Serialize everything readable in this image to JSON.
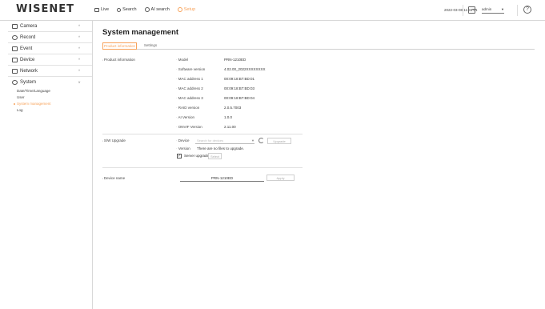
{
  "header": {
    "logo": "WISENET",
    "nav": [
      {
        "label": "Live",
        "icon": "live-icon"
      },
      {
        "label": "Search",
        "icon": "search-icon"
      },
      {
        "label": "AI search",
        "icon": "ai-search-icon"
      },
      {
        "label": "Setup",
        "icon": "gear-icon"
      }
    ],
    "datetime": "2022-03-08 11:33:01",
    "user": "admin",
    "help": "?"
  },
  "sidebar": {
    "groups": [
      {
        "label": "Camera",
        "icon": "camera-icon",
        "chevron": "^"
      },
      {
        "label": "Record",
        "icon": "record-icon",
        "chevron": "^"
      },
      {
        "label": "Event",
        "icon": "event-icon",
        "chevron": "^"
      },
      {
        "label": "Device",
        "icon": "device-icon",
        "chevron": "^"
      },
      {
        "label": "Network",
        "icon": "network-icon",
        "chevron": "^"
      },
      {
        "label": "System",
        "icon": "system-icon",
        "chevron": "v"
      }
    ],
    "system_items": [
      {
        "label": "Date/Time/Language"
      },
      {
        "label": "User"
      },
      {
        "label": "System management"
      },
      {
        "label": "Log"
      }
    ]
  },
  "main": {
    "title": "System management",
    "tabs": [
      "Product information",
      "Settings"
    ],
    "product_info": {
      "section_label": "Product information",
      "rows": [
        {
          "label": "Model",
          "value": "PRN-1210ED"
        },
        {
          "label": "Software version",
          "value": "4.02.00_2022XXXXXXXX"
        },
        {
          "label": "MAC address 1",
          "value": "00:09:18:B7:BD:01"
        },
        {
          "label": "MAC address 2",
          "value": "00:09:18:B7:BD:03"
        },
        {
          "label": "MAC address 3",
          "value": "00:09:18:B7:BD:04"
        },
        {
          "label": "RAID version",
          "value": "2.0.5.7003"
        },
        {
          "label": "AI Version",
          "value": "1.0.0"
        },
        {
          "label": "ONVIF Version",
          "value": "2.11.00"
        }
      ]
    },
    "sw_upgrade": {
      "section_label": "S/W Upgrade",
      "device_label": "Device",
      "device_placeholder": "Search for devices",
      "upgrade_button": "Upgrade",
      "version_label": "Version",
      "version_text": "There are no files to upgrade.",
      "server_upgrade_label": "Server upgrade",
      "server_upgrade_checked": true,
      "server_upgrade_button": "Select"
    },
    "device_name": {
      "section_label": "Device name",
      "value": "PRN-1210ED",
      "apply_button": "Apply"
    }
  }
}
